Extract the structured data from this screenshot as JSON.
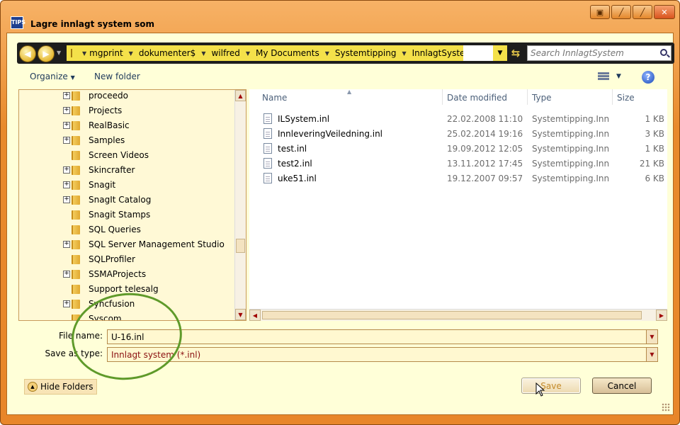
{
  "window": {
    "title": "Lagre innlagt system som",
    "icon_text": "TIPS"
  },
  "address": {
    "crumbs": [
      "mgprint",
      "dokumenter$",
      "wilfred",
      "My Documents",
      "Systemtipping",
      "InnlagtSystem"
    ],
    "search_placeholder": "Search InnlagtSystem"
  },
  "toolbar": {
    "organize": "Organize",
    "new_folder": "New folder"
  },
  "tree": {
    "items": [
      {
        "label": "proceedo",
        "expandable": true
      },
      {
        "label": "Projects",
        "expandable": true
      },
      {
        "label": "RealBasic",
        "expandable": true
      },
      {
        "label": "Samples",
        "expandable": true
      },
      {
        "label": "Screen Videos",
        "expandable": false
      },
      {
        "label": "Skincrafter",
        "expandable": true
      },
      {
        "label": "Snagit",
        "expandable": true
      },
      {
        "label": "SnagIt Catalog",
        "expandable": true
      },
      {
        "label": "Snagit Stamps",
        "expandable": false
      },
      {
        "label": "SQL Queries",
        "expandable": false
      },
      {
        "label": "SQL Server Management Studio",
        "expandable": true
      },
      {
        "label": "SQLProfiler",
        "expandable": false
      },
      {
        "label": "SSMAProjects",
        "expandable": true
      },
      {
        "label": "Support telesalg",
        "expandable": false
      },
      {
        "label": "Syncfusion",
        "expandable": true
      },
      {
        "label": "Syscom",
        "expandable": false
      }
    ]
  },
  "filelist": {
    "columns": {
      "name": "Name",
      "date": "Date modified",
      "type": "Type",
      "size": "Size"
    },
    "files": [
      {
        "name": "ILSystem.inl",
        "date": "22.02.2008 11:10",
        "type": "Systemtipping.Inn...",
        "size": "1 KB"
      },
      {
        "name": "InnleveringVeiledning.inl",
        "date": "25.02.2014 19:16",
        "type": "Systemtipping.Inn...",
        "size": "3 KB"
      },
      {
        "name": "test.inl",
        "date": "19.09.2012 12:05",
        "type": "Systemtipping.Inn...",
        "size": "1 KB"
      },
      {
        "name": "test2.inl",
        "date": "13.11.2012 17:45",
        "type": "Systemtipping.Inn...",
        "size": "21 KB"
      },
      {
        "name": "uke51.inl",
        "date": "19.12.2007 09:57",
        "type": "Systemtipping.Inn...",
        "size": "6 KB"
      }
    ]
  },
  "form": {
    "file_name_label": "File name:",
    "file_name_value": "U-16.inl",
    "save_type_label": "Save as type:",
    "save_type_value": "Innlagt system (*.inl)"
  },
  "buttons": {
    "hide_folders": "Hide Folders",
    "save": "Save",
    "cancel": "Cancel"
  },
  "colors": {
    "frame": "#e8862a",
    "client": "#ffffd8",
    "breadcrumb": "#f4e14a",
    "annotation": "#5f9a2a"
  }
}
